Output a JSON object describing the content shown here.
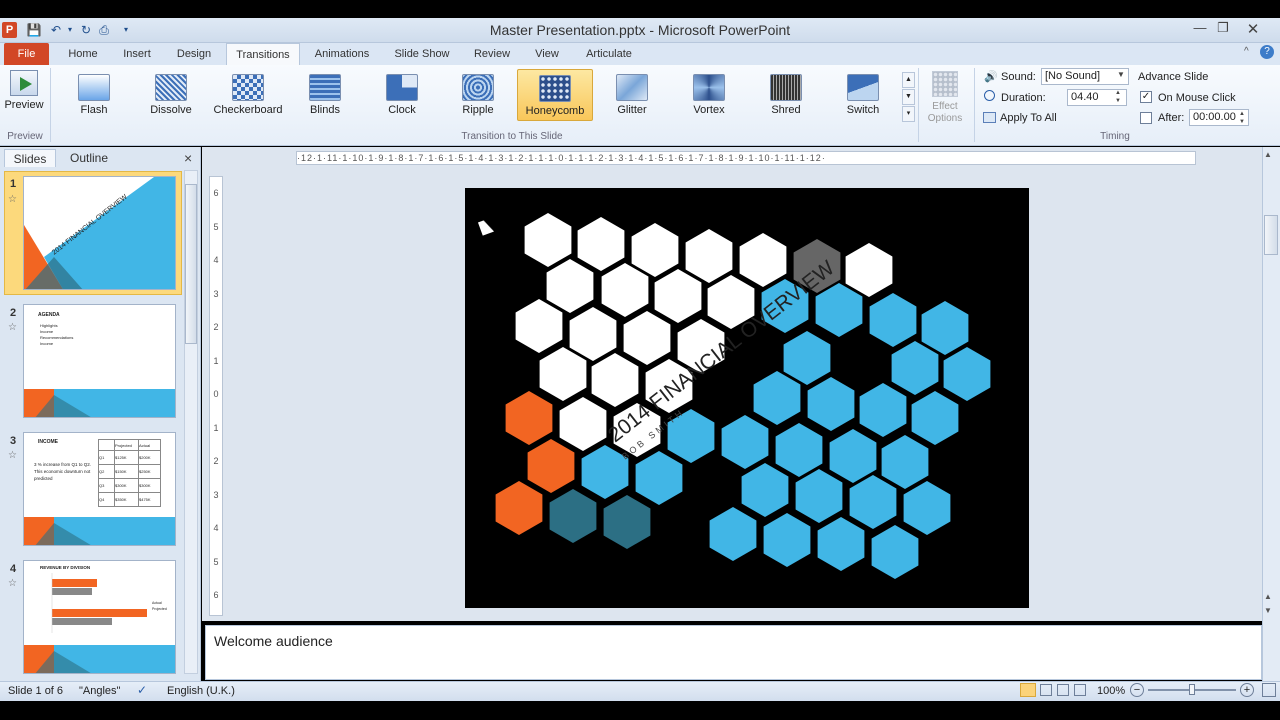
{
  "window": {
    "title": "Master Presentation.pptx - Microsoft PowerPoint"
  },
  "tabs": [
    "File",
    "Home",
    "Insert",
    "Design",
    "Transitions",
    "Animations",
    "Slide Show",
    "Review",
    "View",
    "Articulate"
  ],
  "preview": {
    "label": "Preview",
    "group": "Preview"
  },
  "transitions": [
    "Flash",
    "Dissolve",
    "Checkerboard",
    "Blinds",
    "Clock",
    "Ripple",
    "Honeycomb",
    "Glitter",
    "Vortex",
    "Shred",
    "Switch"
  ],
  "selected_transition": "Honeycomb",
  "transition_group": "Transition to This Slide",
  "effect_options": "Effect Options",
  "timing": {
    "sound_label": "Sound:",
    "sound_value": "[No Sound]",
    "duration_label": "Duration:",
    "duration_value": "04.40",
    "apply_all": "Apply To All",
    "advance_title": "Advance Slide",
    "on_mouse_click": "On Mouse Click",
    "on_mouse_click_checked": true,
    "after_label": "After:",
    "after_value": "00:00.00",
    "after_checked": false,
    "group": "Timing"
  },
  "panel": {
    "tab_slides": "Slides",
    "tab_outline": "Outline",
    "close": "×"
  },
  "thumbnails": [
    {
      "num": "1",
      "title": "2014 FINANCIAL OVERVIEW"
    },
    {
      "num": "2",
      "title": "AGENDA",
      "bullets": [
        "Highlights",
        "Income",
        "Recommendations",
        "Income"
      ]
    },
    {
      "num": "3",
      "title": "INCOME",
      "text": "3 % increase from Q1 to Q2. This economic downturn not predicted",
      "table": {
        "headers": [
          "",
          "Projected",
          "Actual"
        ],
        "rows": [
          [
            "Q1",
            "$125K",
            "$200K"
          ],
          [
            "Q2",
            "$150K",
            "$250K"
          ],
          [
            "Q3",
            "$300K",
            "$300K"
          ],
          [
            "Q4",
            "$350K",
            "$475K"
          ]
        ]
      }
    },
    {
      "num": "4",
      "title": "REVENUE BY DIVISION",
      "legend": [
        "Actual",
        "Projected"
      ]
    }
  ],
  "ruler": {
    "h": "·12·1·11·1·10·1·9·1·8·1·7·1·6·1·5·1·4·1·3·1·2·1·1·1·0·1·1·1·2·1·3·1·4·1·5·1·6·1·7·1·8·1·9·1·10·1·11·1·12·",
    "v": [
      "6",
      "5",
      "4",
      "3",
      "2",
      "1",
      "0",
      "1",
      "2",
      "3",
      "4",
      "5",
      "6"
    ]
  },
  "slide": {
    "title": "2014 FINANCIAL OVERVIEW",
    "subtitle": "BOB SMITH"
  },
  "notes": "Welcome audience",
  "status": {
    "slide": "Slide 1 of 6",
    "theme": "\"Angles\"",
    "language": "English (U.K.)",
    "zoom": "100%"
  },
  "colors": {
    "orange": "#f26522",
    "blue": "#41b6e6",
    "darkteal": "#2c6f84",
    "ribbon_selected": "#f9c75a"
  }
}
